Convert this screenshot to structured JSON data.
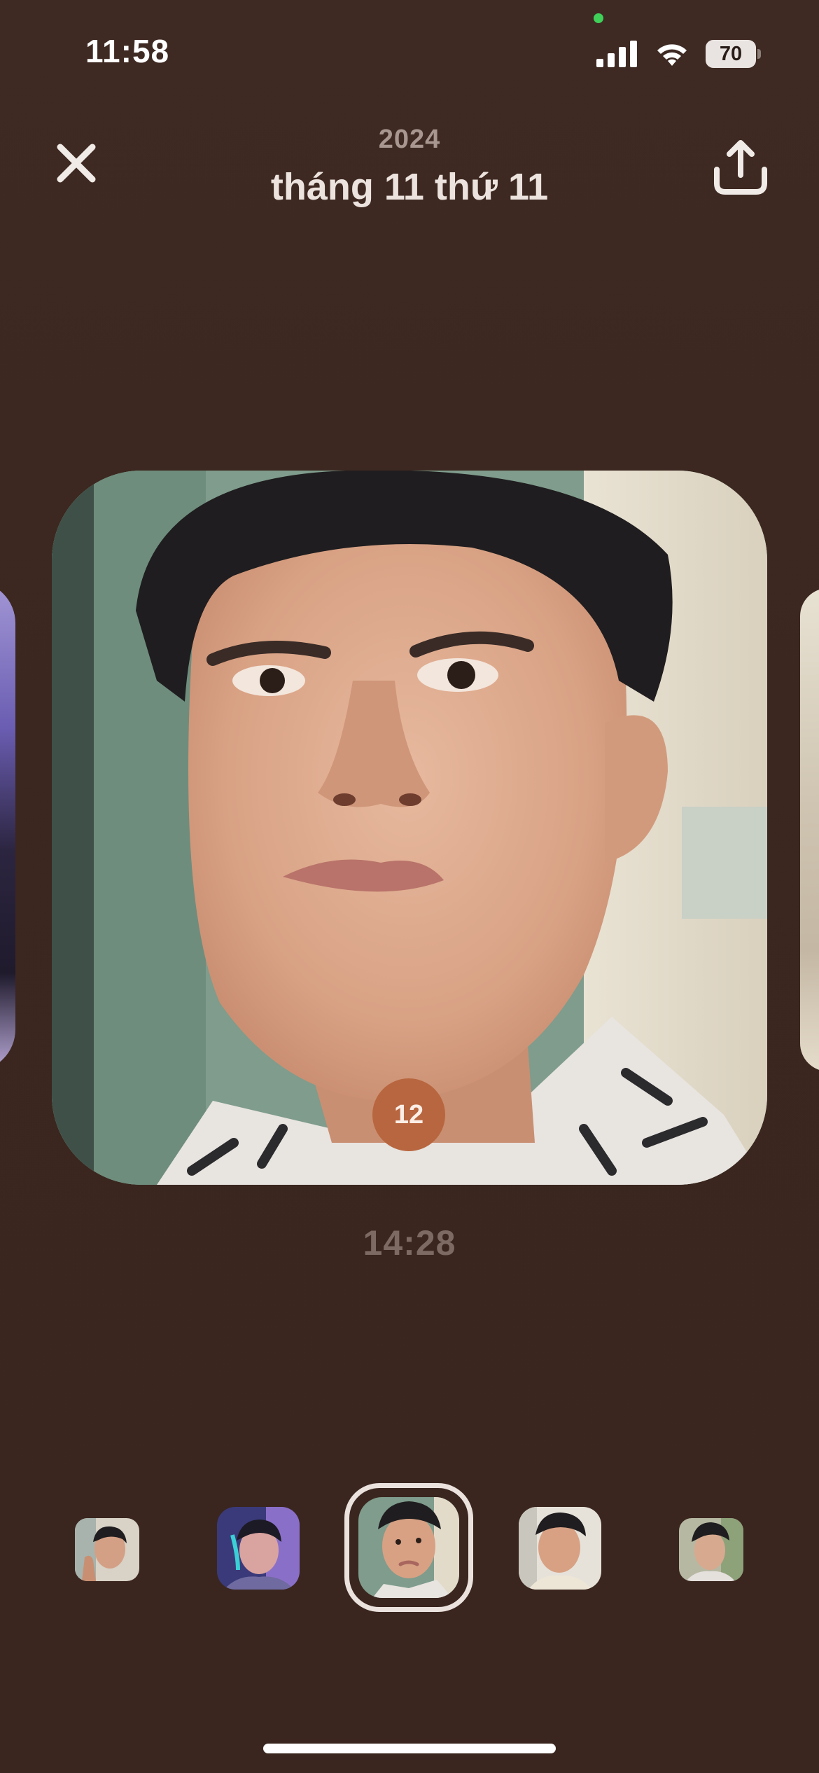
{
  "status_bar": {
    "time": "11:58",
    "battery": "70",
    "icons": [
      "signal-icon",
      "wifi-icon",
      "battery-icon"
    ]
  },
  "header": {
    "year": "2024",
    "title": "tháng 11 thứ 11",
    "close_icon": "close-icon",
    "share_icon": "share-icon"
  },
  "photo": {
    "counter": "12",
    "time": "14:28"
  },
  "thumbnails": [
    {
      "id": "thumb-1",
      "selected": false
    },
    {
      "id": "thumb-2",
      "selected": false
    },
    {
      "id": "thumb-3",
      "selected": true
    },
    {
      "id": "thumb-4",
      "selected": false
    },
    {
      "id": "thumb-5",
      "selected": false
    }
  ],
  "colors": {
    "background": "#3b271f",
    "badge": "#b8663f",
    "selected_frame": "#ebe2de"
  }
}
